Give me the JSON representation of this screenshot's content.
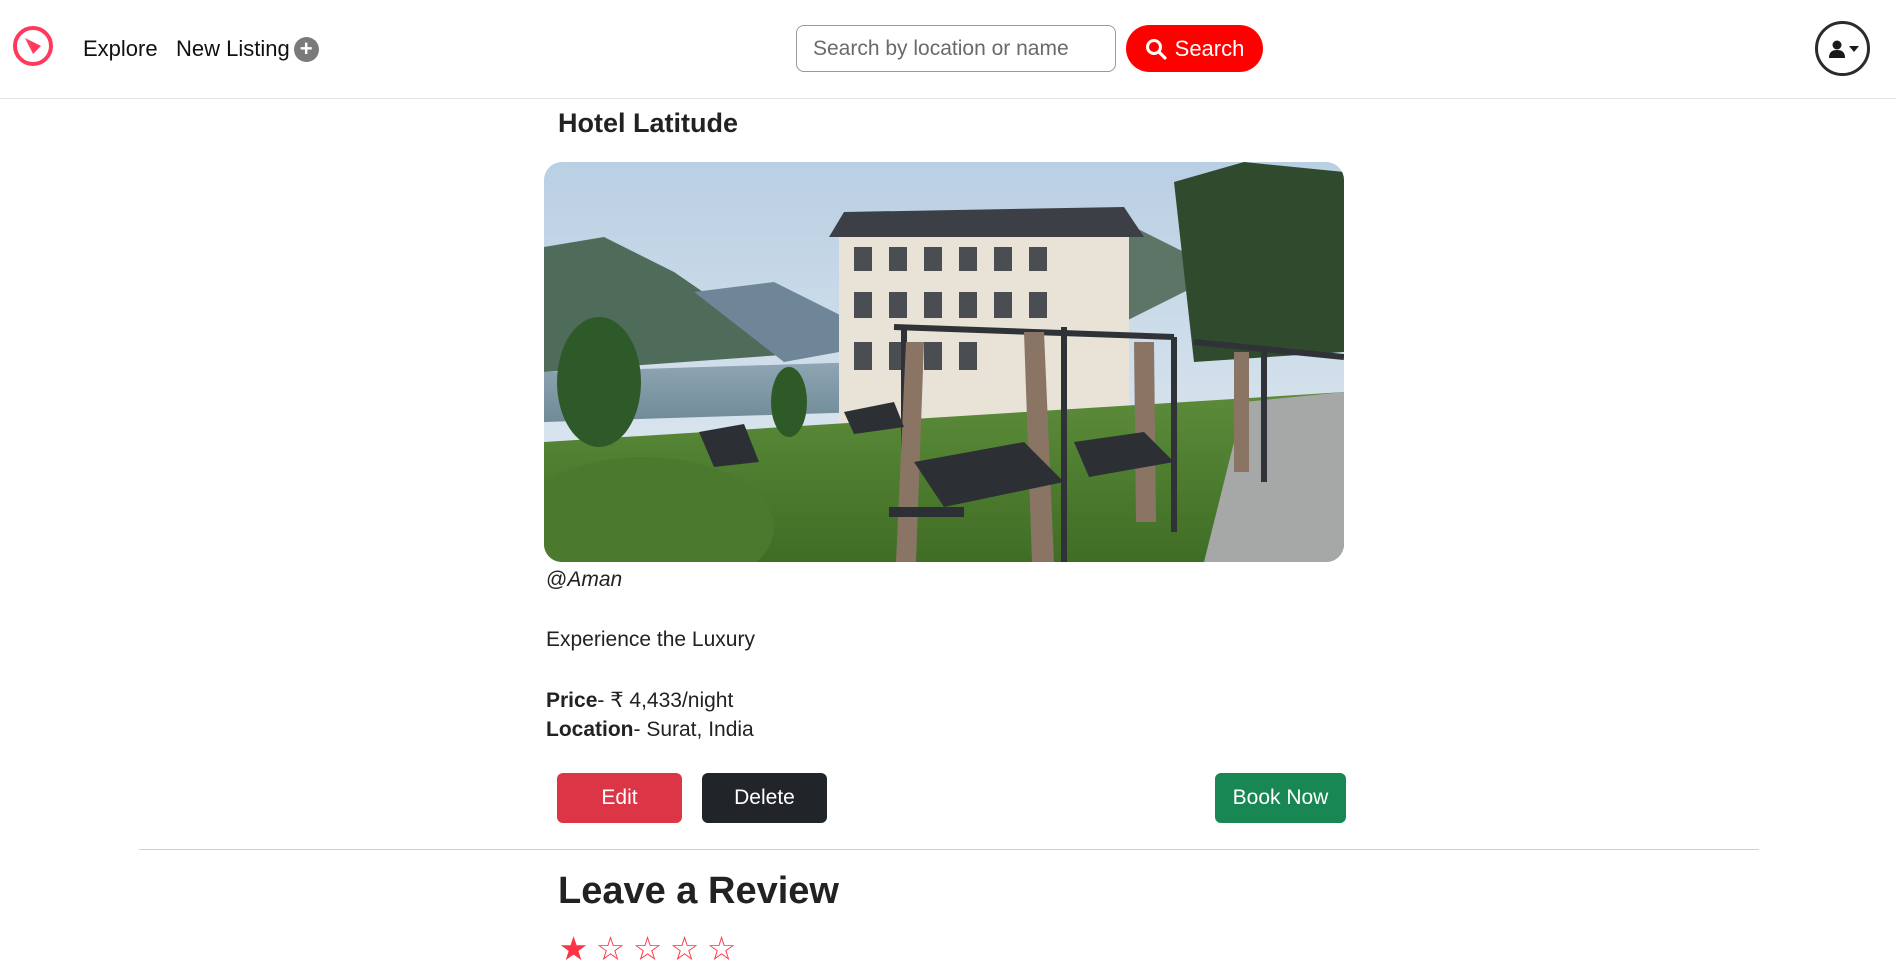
{
  "nav": {
    "explore_label": "Explore",
    "new_listing_label": "New Listing",
    "search_placeholder": "Search by location or name",
    "search_button_label": "Search"
  },
  "listing": {
    "title": "Hotel Latitude",
    "owner_prefix": "@",
    "owner": "Aman",
    "description": "Experience the Luxury",
    "price_label": "Price",
    "price_value": "- ₹ 4,433/night",
    "location_label": "Location",
    "location_value": "- Surat, India"
  },
  "actions": {
    "edit_label": "Edit",
    "delete_label": "Delete",
    "book_label": "Book Now"
  },
  "review": {
    "heading": "Leave a Review",
    "stars": [
      "★",
      "☆",
      "☆",
      "☆",
      "☆"
    ],
    "rating": 1
  },
  "colors": {
    "brand": "#ff0000",
    "edit": "#dc3545",
    "delete": "#212529",
    "book": "#198754",
    "star": "#ff3344"
  },
  "icons": {
    "logo": "compass-icon",
    "plus": "plus-circle-icon",
    "search": "search-icon",
    "user": "user-icon",
    "caret": "caret-down-icon"
  }
}
